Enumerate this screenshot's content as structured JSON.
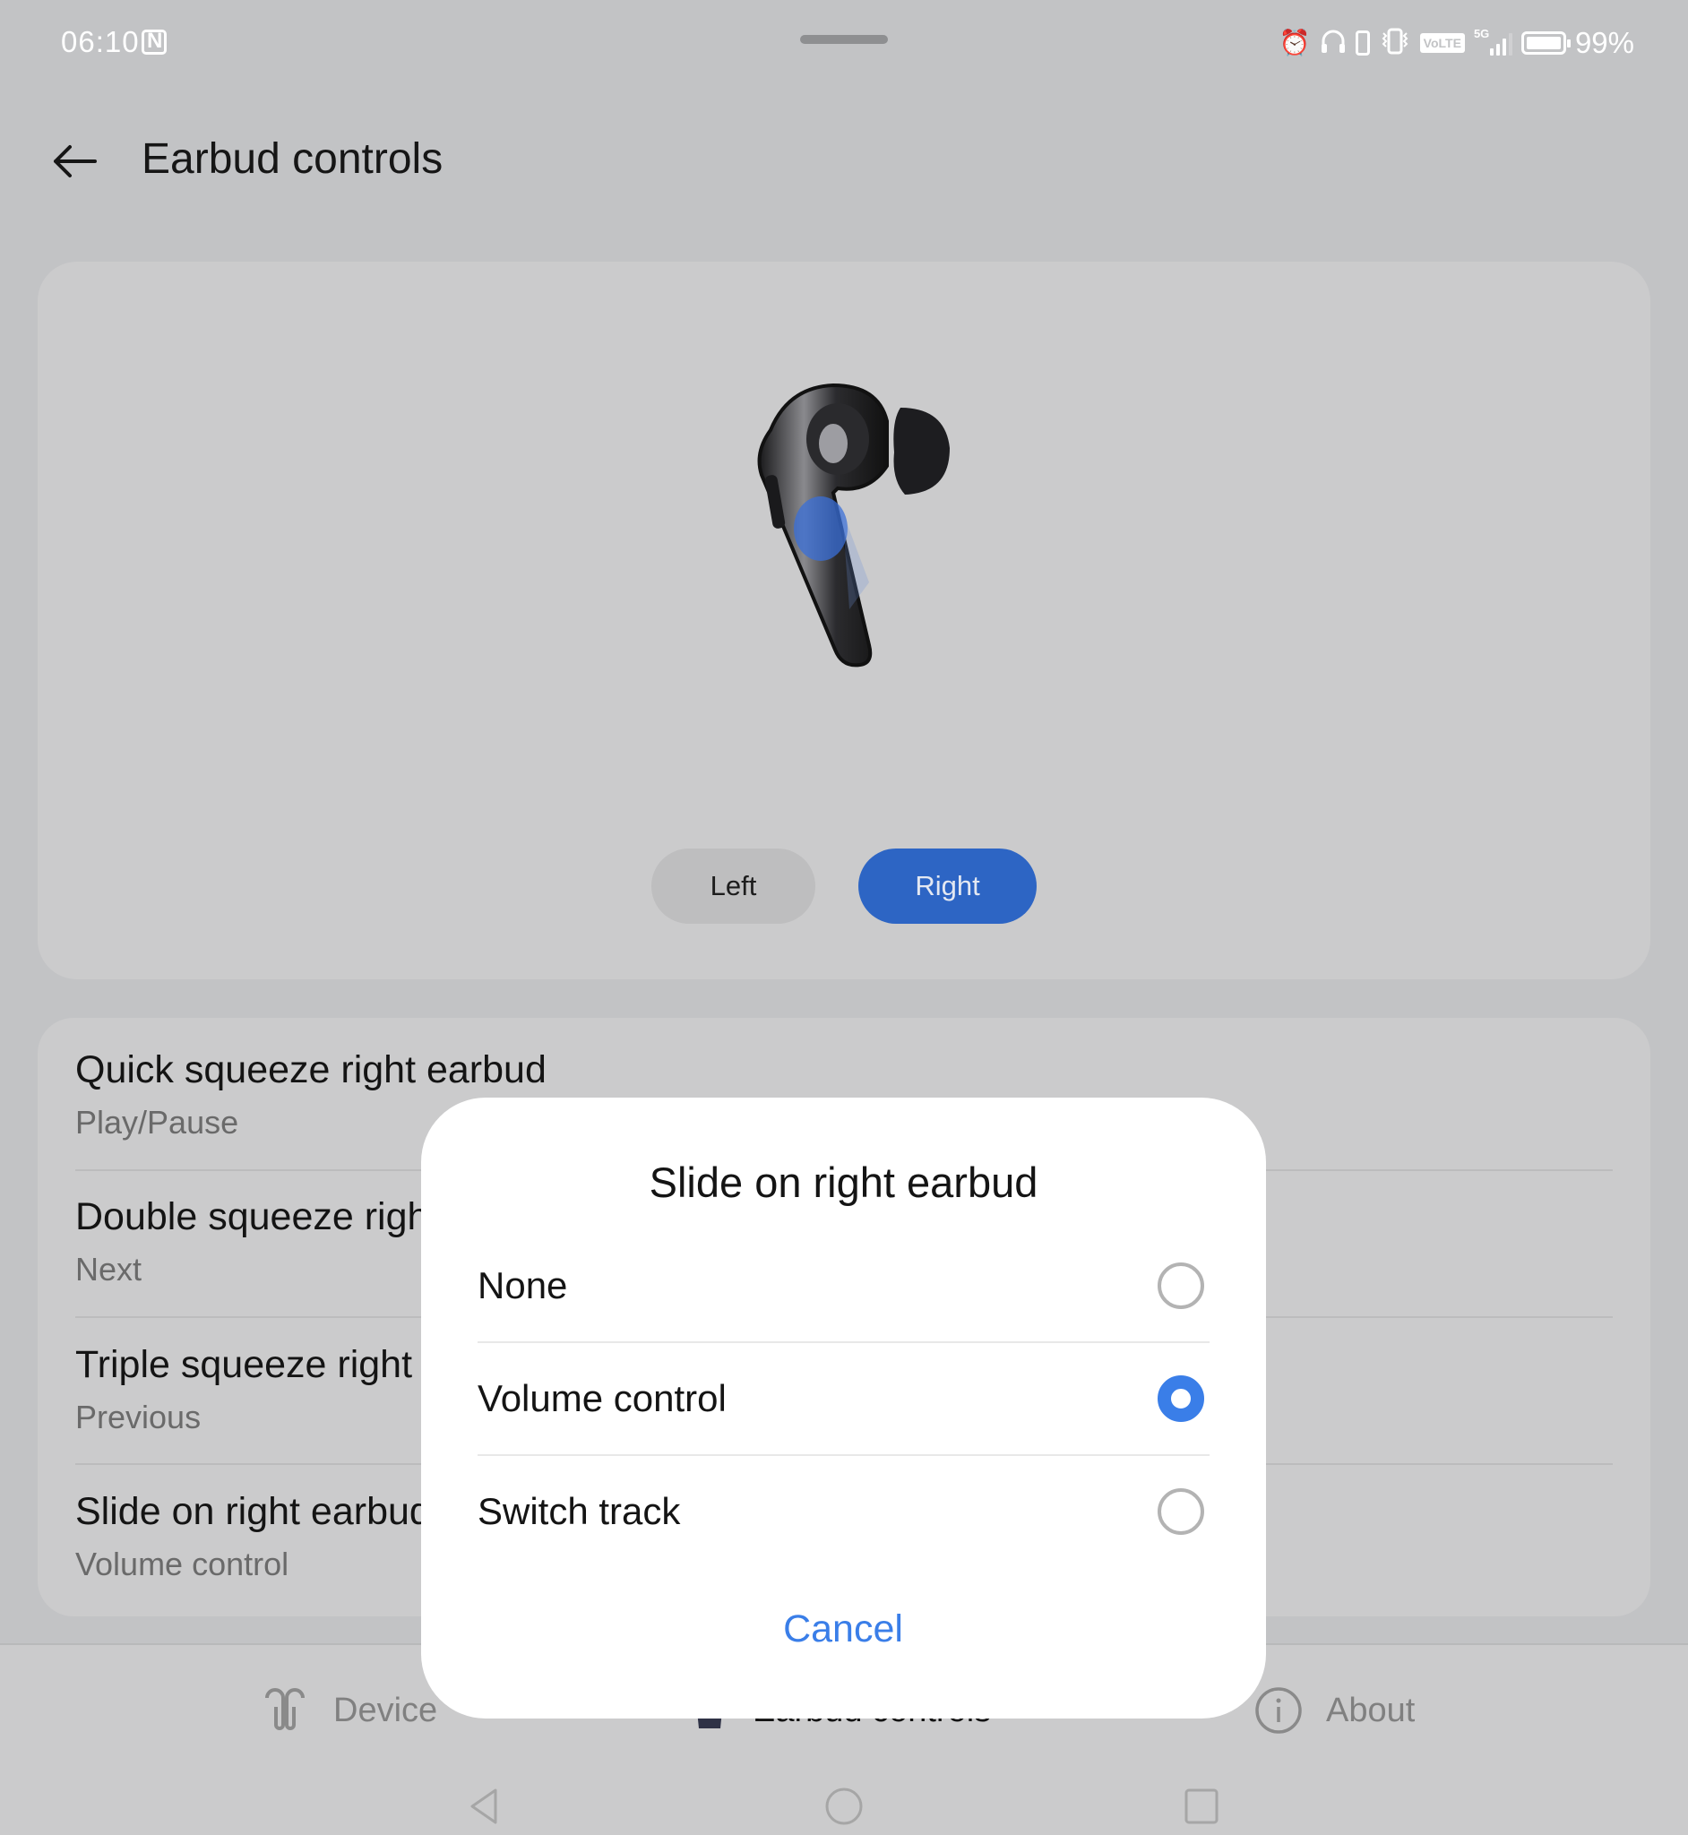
{
  "status_bar": {
    "time": "06:10",
    "left_icons": [
      "nfc-icon"
    ],
    "right_icons": [
      "alarm-icon",
      "headphones-icon",
      "earbud-battery-icon",
      "vibrate-icon",
      "volte-icon",
      "signal-5g-icon",
      "battery-icon"
    ],
    "volte_label": "VoLTE",
    "network_label": "5G",
    "battery_percent": "99%",
    "battery_level": 0.99
  },
  "header": {
    "back_icon": "arrow-left-icon",
    "title": "Earbud controls"
  },
  "earbud_view": {
    "image": "right-earbud-illustration",
    "highlight": "slide-zone",
    "side_selector": [
      {
        "label": "Left",
        "selected": false
      },
      {
        "label": "Right",
        "selected": true
      }
    ]
  },
  "settings": [
    {
      "title": "Quick squeeze right earbud",
      "value": "Play/Pause"
    },
    {
      "title": "Double squeeze right earbud",
      "value": "Next"
    },
    {
      "title": "Triple squeeze right earbud",
      "value": "Previous"
    },
    {
      "title": "Slide on right earbud",
      "value": "Volume control"
    }
  ],
  "bottom_nav": [
    {
      "label": "Device",
      "icon": "earbuds-icon",
      "active": false
    },
    {
      "label": "Earbud controls",
      "icon": "earbud-icon",
      "active": true
    },
    {
      "label": "About",
      "icon": "info-icon",
      "active": false
    }
  ],
  "system_nav": {
    "back": "back-triangle-icon",
    "home": "home-circle-icon",
    "recents": "recents-square-icon"
  },
  "dialog": {
    "title": "Slide on right earbud",
    "options": [
      {
        "label": "None",
        "selected": false
      },
      {
        "label": "Volume control",
        "selected": true
      },
      {
        "label": "Switch track",
        "selected": false
      }
    ],
    "cancel_label": "Cancel"
  },
  "colors": {
    "accent": "#2d65c4",
    "radio_accent": "#3a7ee8",
    "background": "#c2c3c5",
    "card": "#cbcbcc"
  }
}
